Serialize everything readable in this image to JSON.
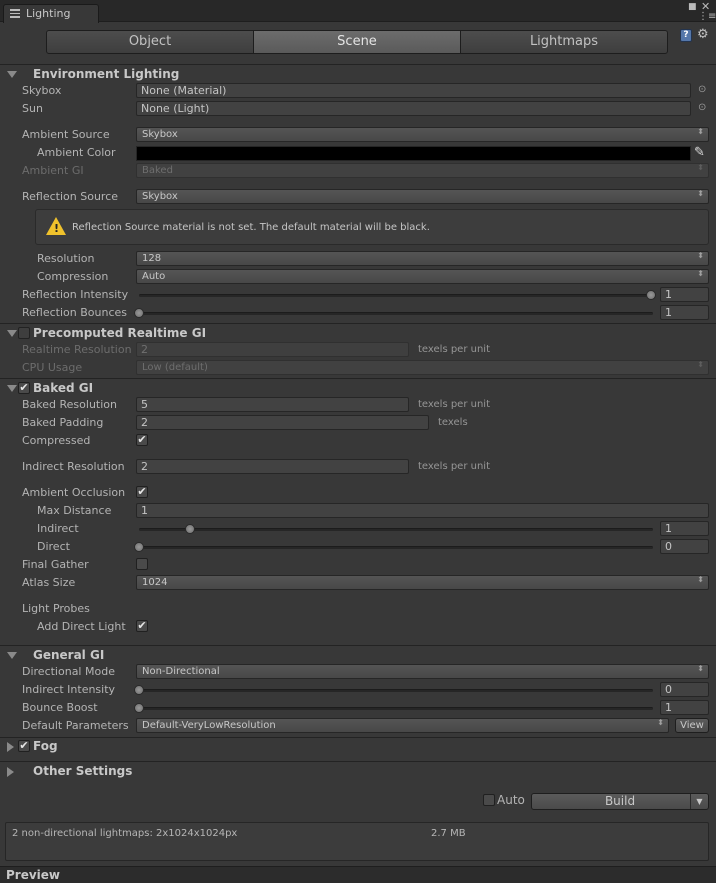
{
  "window": {
    "tab_title": "Lighting"
  },
  "tabs": [
    {
      "label": "Object",
      "active": false
    },
    {
      "label": "Scene",
      "active": true
    },
    {
      "label": "Lightmaps",
      "active": false
    }
  ],
  "environment": {
    "header": "Environment Lighting",
    "skybox_label": "Skybox",
    "skybox_value": "None (Material)",
    "sun_label": "Sun",
    "sun_value": "None (Light)",
    "ambient_source_label": "Ambient Source",
    "ambient_source_value": "Skybox",
    "ambient_color_label": "Ambient Color",
    "ambient_color_value": "#000000",
    "ambient_gi_label": "Ambient GI",
    "ambient_gi_value": "Baked",
    "reflection_source_label": "Reflection Source",
    "reflection_source_value": "Skybox",
    "warning": "Reflection Source material is not set. The default material will be black.",
    "resolution_label": "Resolution",
    "resolution_value": "128",
    "compression_label": "Compression",
    "compression_value": "Auto",
    "reflection_intensity_label": "Reflection Intensity",
    "reflection_intensity_value": "1",
    "reflection_intensity_fraction": 1.0,
    "reflection_bounces_label": "Reflection Bounces",
    "reflection_bounces_value": "1",
    "reflection_bounces_fraction": 0.0
  },
  "realtime": {
    "header": "Precomputed Realtime GI",
    "enabled": false,
    "resolution_label": "Realtime Resolution",
    "resolution_value": "2",
    "resolution_unit": "texels per unit",
    "cpu_label": "CPU Usage",
    "cpu_value": "Low (default)"
  },
  "baked": {
    "header": "Baked GI",
    "enabled": true,
    "resolution_label": "Baked Resolution",
    "resolution_value": "5",
    "resolution_unit": "texels per unit",
    "padding_label": "Baked Padding",
    "padding_value": "2",
    "padding_unit": "texels",
    "compressed_label": "Compressed",
    "compressed": true,
    "indirect_res_label": "Indirect Resolution",
    "indirect_res_value": "2",
    "indirect_res_unit": "texels per unit",
    "ao_label": "Ambient Occlusion",
    "ao": true,
    "max_distance_label": "Max Distance",
    "max_distance_value": "1",
    "indirect_label": "Indirect",
    "indirect_value": "1",
    "indirect_fraction": 0.1,
    "direct_label": "Direct",
    "direct_value": "0",
    "direct_fraction": 0.0,
    "final_gather_label": "Final Gather",
    "final_gather": false,
    "atlas_label": "Atlas Size",
    "atlas_value": "1024",
    "light_probes_label": "Light Probes",
    "add_direct_label": "Add Direct Light",
    "add_direct": true
  },
  "general": {
    "header": "General GI",
    "directional_label": "Directional Mode",
    "directional_value": "Non-Directional",
    "indirect_intensity_label": "Indirect Intensity",
    "indirect_intensity_value": "0",
    "indirect_intensity_fraction": 0.0,
    "bounce_label": "Bounce Boost",
    "bounce_value": "1",
    "bounce_fraction": 0.0,
    "default_params_label": "Default Parameters",
    "default_params_value": "Default-VeryLowResolution",
    "view_label": "View"
  },
  "fog": {
    "header": "Fog",
    "enabled": true
  },
  "other": {
    "header": "Other Settings"
  },
  "build": {
    "auto_label": "Auto",
    "auto": false,
    "build_label": "Build"
  },
  "status": {
    "lightmaps": "2 non-directional lightmaps: 2x1024x1024px",
    "size": "2.7 MB"
  },
  "preview_label": "Preview",
  "icons": {
    "check": "✔",
    "picker": "⊙",
    "dropdown": "⬍",
    "eyedropper": "✎",
    "help": "?",
    "gear": "⚙"
  }
}
